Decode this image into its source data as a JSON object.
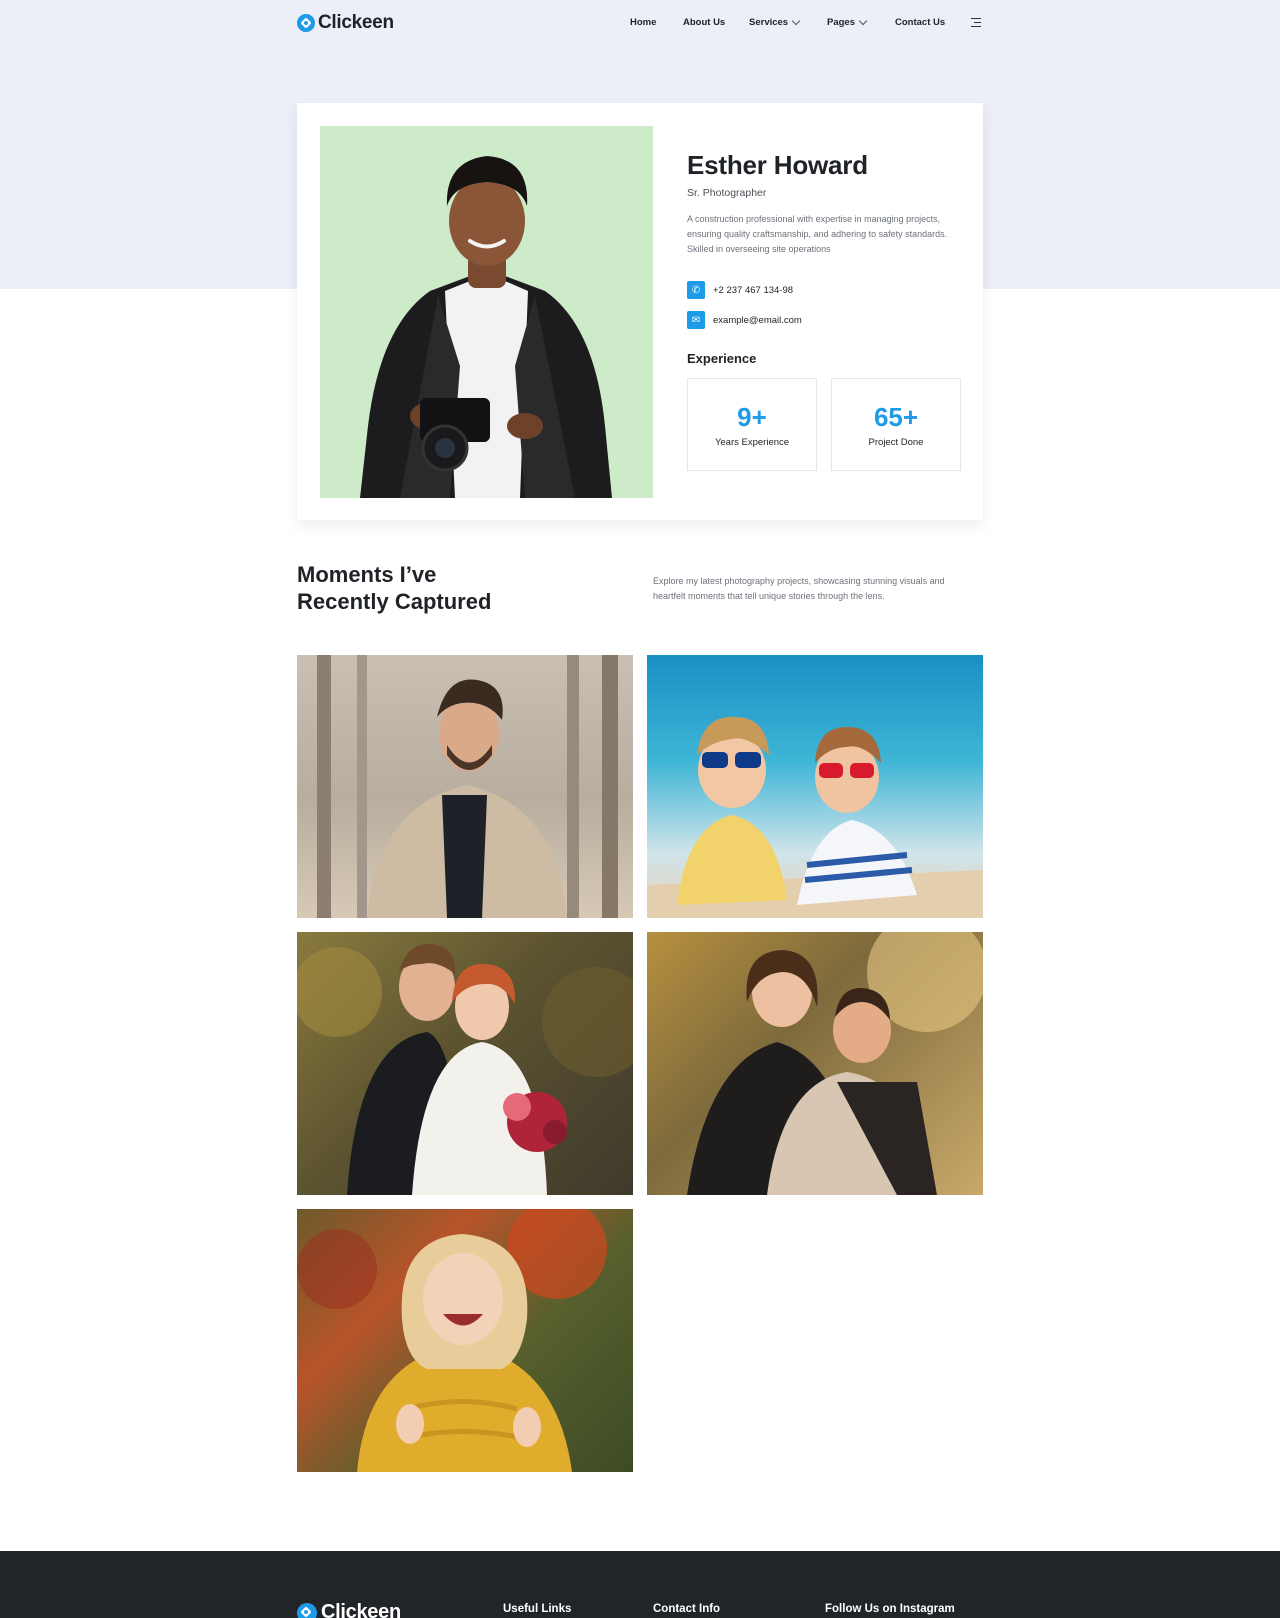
{
  "brand": {
    "name": "Clickeen",
    "accent": "#1d9be6"
  },
  "nav": {
    "items": [
      {
        "label": "Home"
      },
      {
        "label": "About Us"
      },
      {
        "label": "Services",
        "has_dropdown": true
      },
      {
        "label": "Pages",
        "has_dropdown": true
      },
      {
        "label": "Contact Us"
      }
    ],
    "menu_icon": "hamburger-menu-icon"
  },
  "profile": {
    "name": "Esther Howard",
    "role": "Sr. Photographer",
    "description": "A construction professional with expertise in managing projects, ensuring quality craftsmanship, and adhering to safety standards. Skilled in overseeing site operations",
    "phone": "+2 237 467 134-98",
    "email": "example@email.com",
    "experience_title": "Experience",
    "stats": [
      {
        "value": "9+",
        "label": "Years Experience"
      },
      {
        "value": "65+",
        "label": "Project Done"
      }
    ]
  },
  "moments": {
    "title_line1": "Moments I’ve",
    "title_line2": "Recently Captured",
    "description": "Explore my latest photography projects, showcasing stunning visuals and heartfelt moments that tell unique stories through the lens.",
    "photos": [
      {
        "name": "man-in-forest-photo"
      },
      {
        "name": "girls-on-beach-photo"
      },
      {
        "name": "wedding-couple-photo"
      },
      {
        "name": "couple-piggyback-photo"
      },
      {
        "name": "laughing-girl-photo"
      }
    ]
  },
  "footer": {
    "columns": [
      {
        "title": "Useful Links"
      },
      {
        "title": "Contact Info"
      },
      {
        "title": "Follow Us on Instagram"
      }
    ]
  }
}
